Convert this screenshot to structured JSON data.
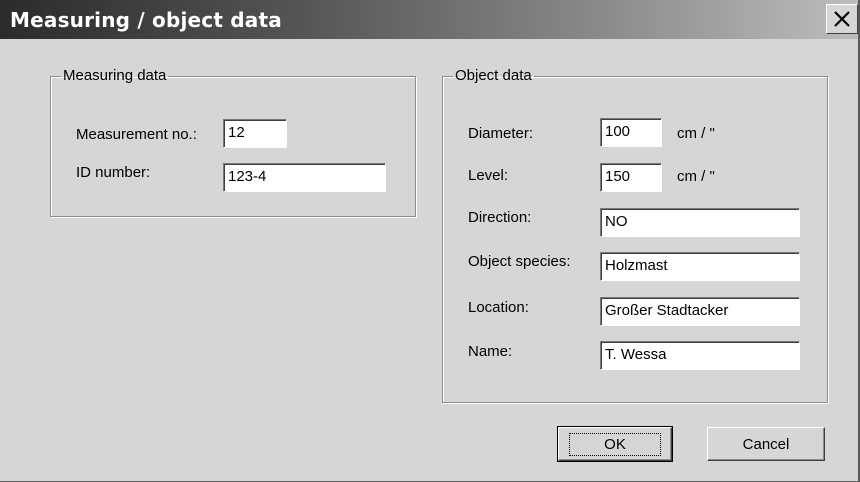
{
  "window": {
    "title": "Measuring / object data",
    "close_icon": "close-icon"
  },
  "measuring": {
    "legend": "Measuring data",
    "measurement_no_label": "Measurement no.:",
    "measurement_no_value": "12",
    "id_number_label": "ID number:",
    "id_number_value": "123-4"
  },
  "object": {
    "legend": "Object data",
    "diameter_label": "Diameter:",
    "diameter_value": "100",
    "diameter_unit": "cm / \"",
    "level_label": "Level:",
    "level_value": "150",
    "level_unit": "cm / \"",
    "direction_label": "Direction:",
    "direction_value": "NO",
    "species_label": "Object species:",
    "species_value": "Holzmast",
    "location_label": "Location:",
    "location_value": "Großer Stadtacker",
    "name_label": "Name:",
    "name_value": "T. Wessa"
  },
  "buttons": {
    "ok_label": "OK",
    "cancel_label": "Cancel"
  }
}
